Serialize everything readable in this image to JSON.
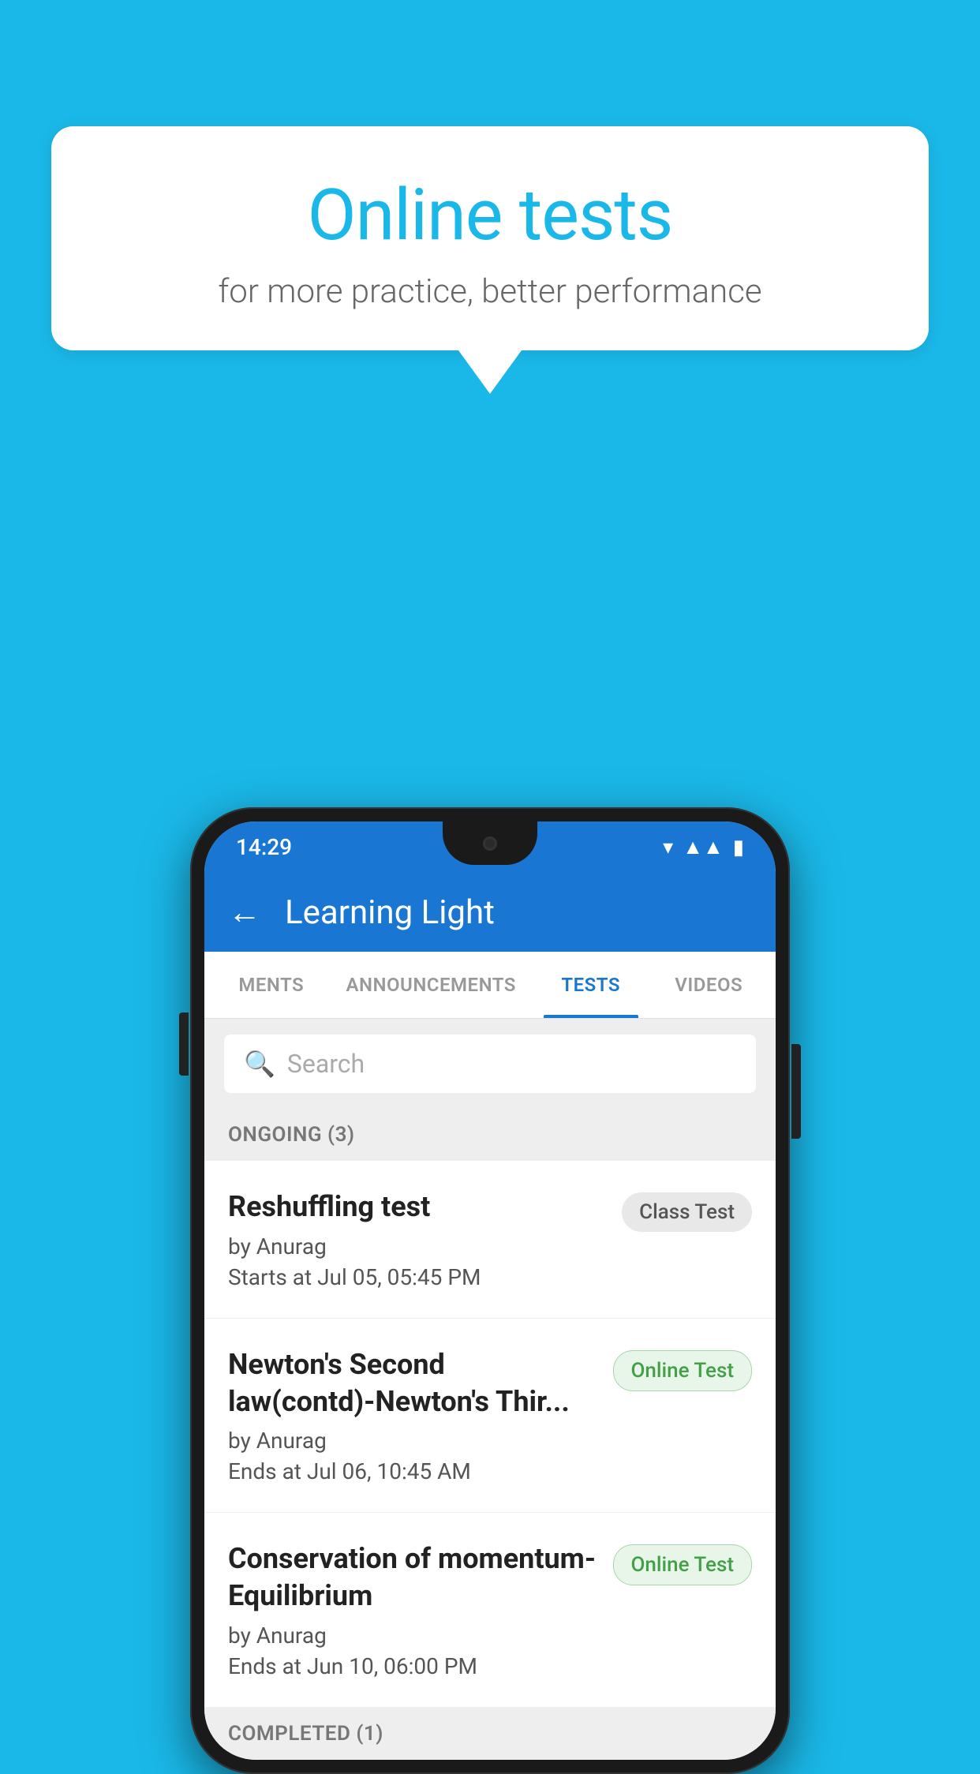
{
  "background": {
    "color": "#1ab8e8"
  },
  "speech_bubble": {
    "title": "Online tests",
    "subtitle": "for more practice, better performance"
  },
  "status_bar": {
    "time": "14:29",
    "wifi_icon": "▾",
    "signal_icon": "◂◂",
    "battery_icon": "▮"
  },
  "app_bar": {
    "back_label": "←",
    "title": "Learning Light"
  },
  "tabs": [
    {
      "label": "MENTS",
      "active": false
    },
    {
      "label": "ANNOUNCEMENTS",
      "active": false
    },
    {
      "label": "TESTS",
      "active": true
    },
    {
      "label": "VIDEOS",
      "active": false
    }
  ],
  "search": {
    "placeholder": "Search"
  },
  "sections": [
    {
      "title": "ONGOING (3)",
      "items": [
        {
          "name": "Reshuffling test",
          "by": "by Anurag",
          "time_label": "Starts at",
          "time": "Jul 05, 05:45 PM",
          "badge": "Class Test",
          "badge_type": "class"
        },
        {
          "name": "Newton's Second law(contd)-Newton's Thir...",
          "by": "by Anurag",
          "time_label": "Ends at",
          "time": "Jul 06, 10:45 AM",
          "badge": "Online Test",
          "badge_type": "online"
        },
        {
          "name": "Conservation of momentum-Equilibrium",
          "by": "by Anurag",
          "time_label": "Ends at",
          "time": "Jun 10, 06:00 PM",
          "badge": "Online Test",
          "badge_type": "online"
        }
      ]
    }
  ],
  "completed_section": {
    "title": "COMPLETED (1)"
  }
}
